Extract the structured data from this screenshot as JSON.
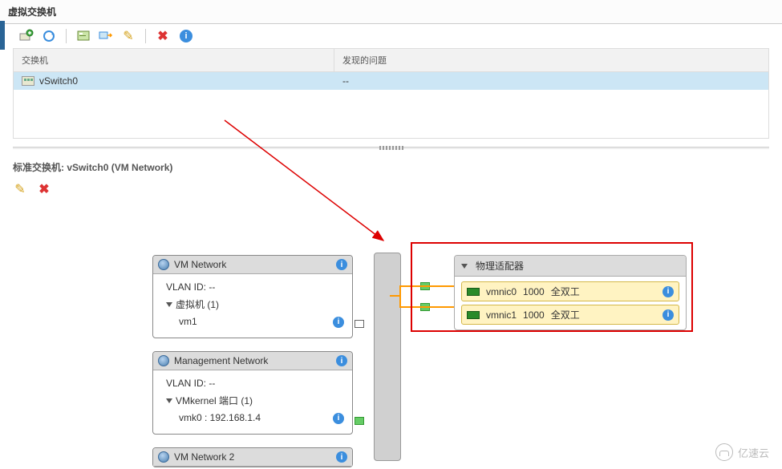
{
  "section": {
    "title": "虚拟交换机"
  },
  "toolbar": {
    "add_icon": "add-switch",
    "refresh_icon": "refresh",
    "settings_icon": "properties",
    "migrate_icon": "migrate",
    "edit_icon": "edit",
    "delete_icon": "delete",
    "info_icon": "info"
  },
  "table": {
    "columns": [
      "交换机",
      "发现的问题"
    ],
    "rows": [
      {
        "name": "vSwitch0",
        "issues": "--"
      }
    ]
  },
  "detail": {
    "label_prefix": "标准交换机: ",
    "switch_name": "vSwitch0 (VM Network)"
  },
  "detail_toolbar": {
    "edit_icon": "edit",
    "delete_icon": "delete"
  },
  "portgroups": [
    {
      "name": "VM Network",
      "vlan_label": "VLAN ID: --",
      "child_label": "虚拟机 (1)",
      "children": [
        "vm1"
      ]
    },
    {
      "name": "Management Network",
      "vlan_label": "VLAN ID: --",
      "child_label": "VMkernel 端口 (1)",
      "children": [
        "vmk0 : 192.168.1.4"
      ]
    },
    {
      "name": "VM Network 2",
      "vlan_label": "",
      "child_label": "",
      "children": []
    }
  ],
  "adapters": {
    "title": "物理适配器",
    "nics": [
      {
        "name": "vmnic0",
        "speed": "1000",
        "duplex": "全双工"
      },
      {
        "name": "vmnic1",
        "speed": "1000",
        "duplex": "全双工"
      }
    ]
  },
  "watermark": "亿速云"
}
